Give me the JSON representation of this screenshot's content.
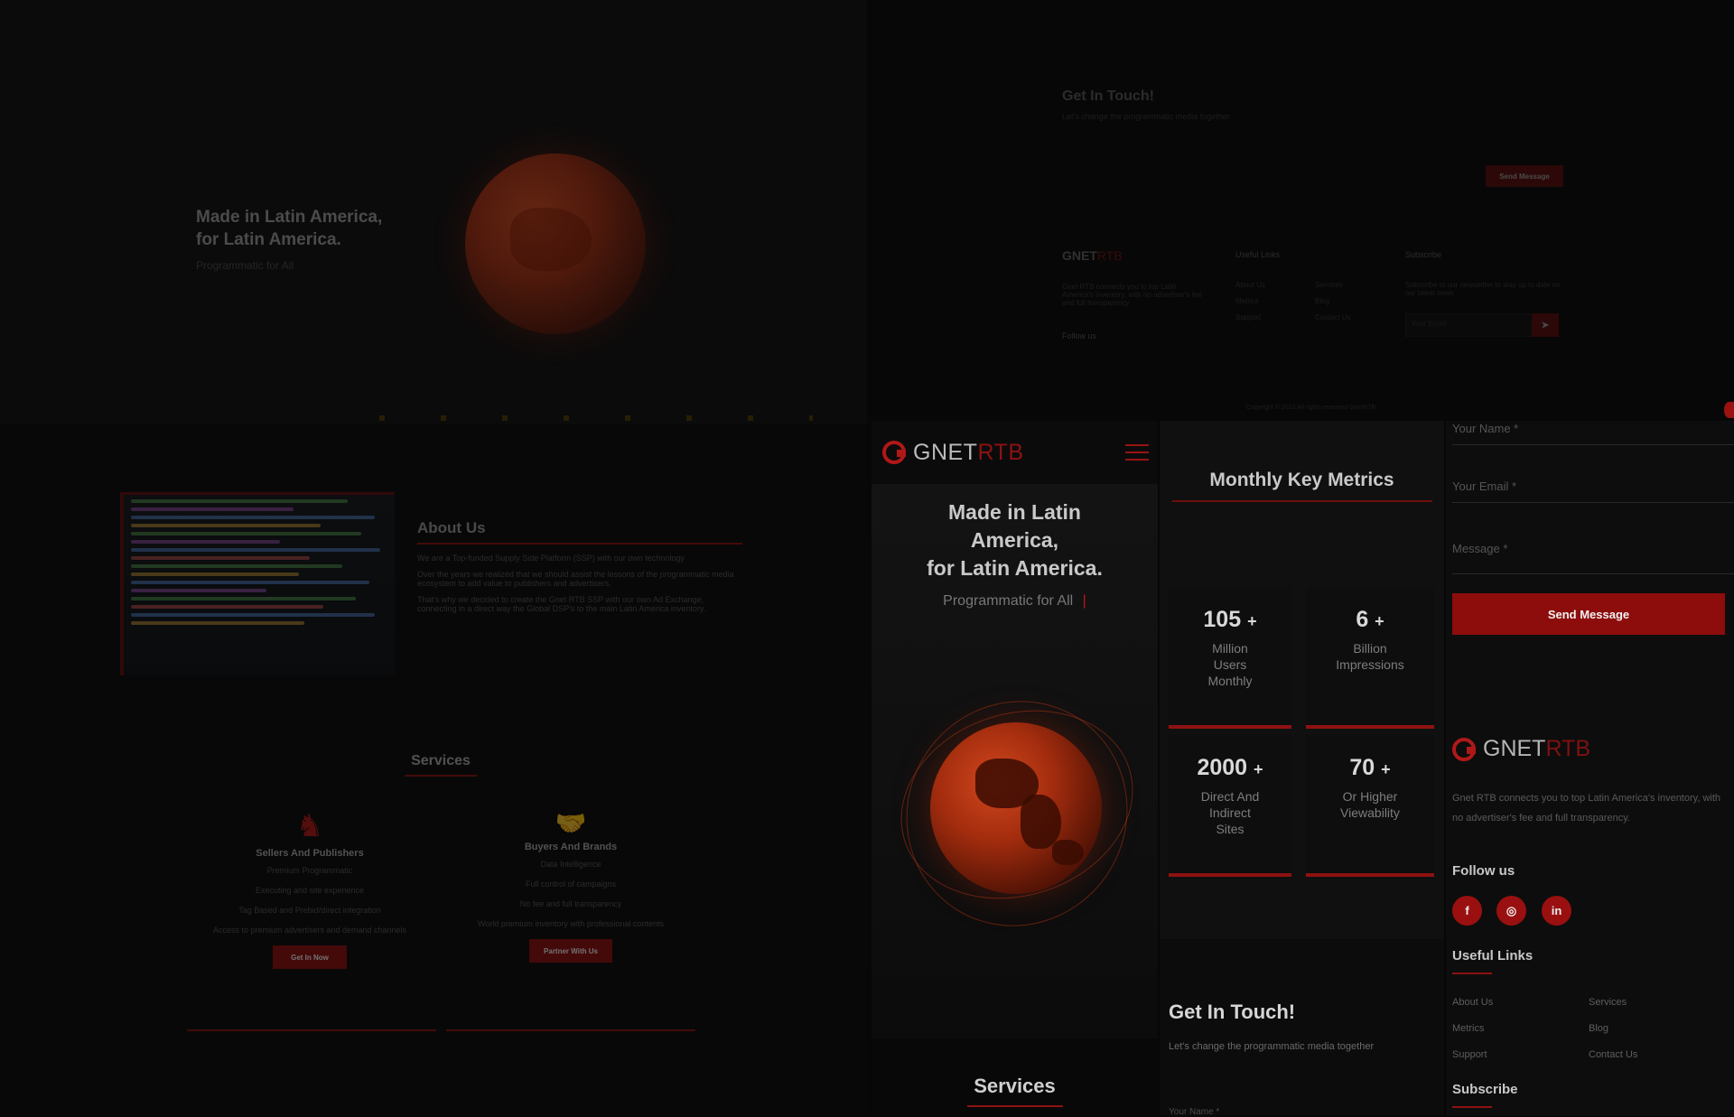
{
  "brand": {
    "name_main": "GNET",
    "name_accent": "RTB",
    "accent_color": "#c81212",
    "bg_color": "#070707"
  },
  "desktop_bg": {
    "hero": {
      "title_line1": "Made in Latin America,",
      "title_line2": "for Latin America.",
      "subtitle": "Programmatic for All"
    },
    "about": {
      "title": "About Us",
      "p1": "We are a Top-funded Supply Side Platform (SSP) with our own technology",
      "p2": "Over the years we realized that we should assist the lessons of the programmatic media ecosystem to add value to publishers and advertisers.",
      "p3": "That's why we decided to create the Gnet RTB SSP with our own Ad Exchange, connecting in a direct way the Global DSP's to the main Latin America inventory."
    },
    "services": {
      "title": "Services",
      "cards": [
        {
          "title": "Sellers And Publishers",
          "items": [
            "Premium Programmatic",
            "Executing and site experience",
            "Tag Based and Prebid/direct integration",
            "Access to premium advertisers and demand channels"
          ],
          "button": "Get In Now"
        },
        {
          "title": "Buyers And Brands",
          "items": [
            "Data Intelligence",
            "Full control of campaigns",
            "No fee and full transparency",
            "World premium inventory with professional contents"
          ],
          "button": "Partner With Us"
        }
      ]
    },
    "contact": {
      "title": "Get In Touch!",
      "subtitle": "Let's change the programmatic media together",
      "send": "Send Message"
    },
    "footer": {
      "desc": "Gnet RTB connects you to top Latin America's inventory, with no advertiser's fee and full transparency.",
      "follow": "Follow us",
      "useful_links_title": "Useful Links",
      "links": [
        "About Us",
        "Services",
        "Metrics",
        "Blog",
        "Support",
        "Contact Us"
      ],
      "subscribe_title": "Subscribe",
      "subscribe_text": "Subscribe to our newsletter to stay up to date on our latest news",
      "email_placeholder": "Your Email",
      "copyright": "Copyright © 2022 All rights reserved GnetRTB"
    }
  },
  "mobile": {
    "hero": {
      "title_line1": "Made in Latin",
      "title_line2": "America,",
      "title_line3": "for Latin America.",
      "subtitle": "Programmatic for All",
      "cursor": "|"
    },
    "services_title": "Services",
    "metrics": {
      "title": "Monthly Key Metrics",
      "cards": [
        {
          "value": "105",
          "plus": "+",
          "label_lines": [
            "Million",
            "Users",
            "Monthly"
          ]
        },
        {
          "value": "6",
          "plus": "+",
          "label_lines": [
            "Billion",
            "Impressions"
          ]
        },
        {
          "value": "2000",
          "plus": "+",
          "label_lines": [
            "Direct And",
            "Indirect",
            "Sites"
          ]
        },
        {
          "value": "70",
          "plus": "+",
          "label_lines": [
            "Or Higher",
            "Viewability"
          ]
        }
      ]
    },
    "contact": {
      "title": "Get In Touch!",
      "subtitle": "Let's change the programmatic media together",
      "name_placeholder": "Your Name *",
      "email_placeholder": "Your Email *",
      "message_placeholder": "Message *",
      "send": "Send Message"
    },
    "footer": {
      "desc": "Gnet RTB connects you to top Latin America's inventory, with no advertiser's fee and full transparency.",
      "follow": "Follow us",
      "social": [
        "f",
        "◎",
        "in"
      ],
      "useful_links_title": "Useful Links",
      "links": [
        "About Us",
        "Services",
        "Metrics",
        "Blog",
        "Support",
        "Contact Us"
      ],
      "subscribe_title": "Subscribe"
    }
  },
  "icons": {
    "menu": "hamburger-menu-icon",
    "sellers": "tiger-icon",
    "buyers": "handshake-icon",
    "send": "send-icon"
  }
}
